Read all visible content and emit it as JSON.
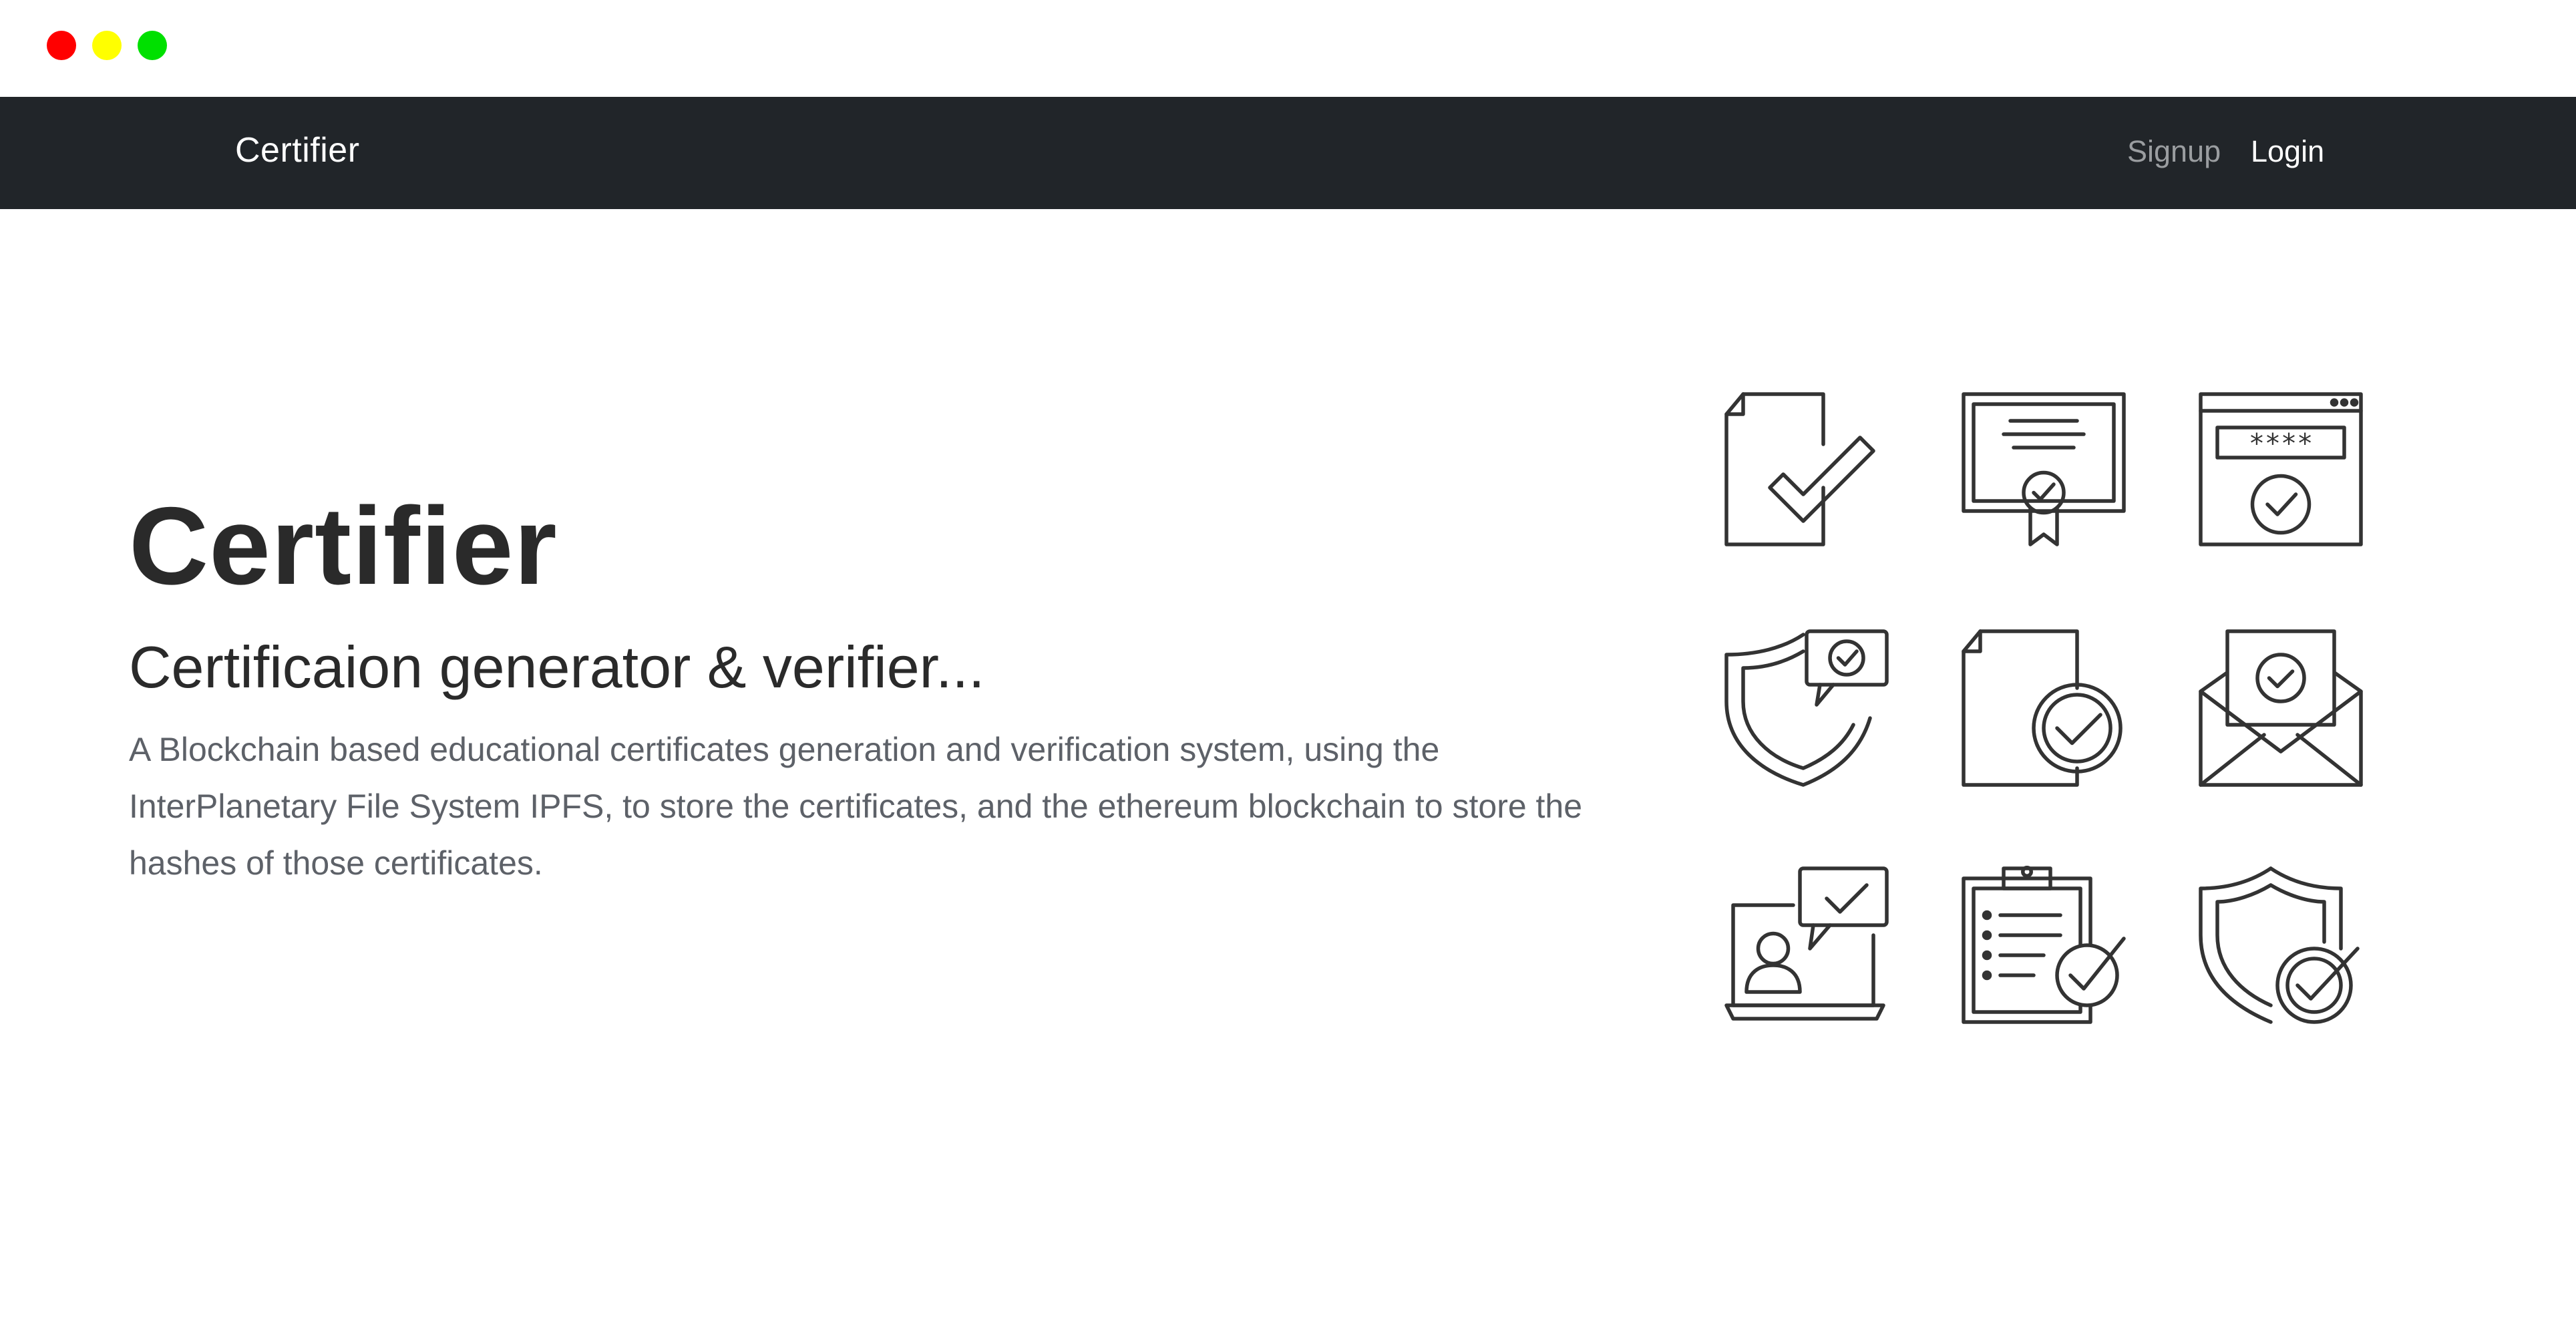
{
  "window": {
    "controls": {
      "close_color": "#ff0000",
      "minimize_color": "#ffff00",
      "maximize_color": "#00e000"
    }
  },
  "navbar": {
    "brand": "Certifier",
    "links": {
      "signup": "Signup",
      "login": "Login"
    },
    "background": "#212529"
  },
  "hero": {
    "title": "Certifier",
    "subtitle": "Certificaion generator & verifier...",
    "description": "A Blockchain based educational certificates generation and verification system, using the InterPlanetary File System IPFS, to store the certificates, and the ethereum blockchain to store the hashes of those certificates."
  },
  "icons": [
    "document-check-icon",
    "certificate-ribbon-icon",
    "password-browser-check-icon",
    "shield-message-check-icon",
    "document-circle-check-icon",
    "envelope-check-icon",
    "laptop-user-check-icon",
    "clipboard-checklist-icon",
    "shield-circle-check-icon"
  ]
}
